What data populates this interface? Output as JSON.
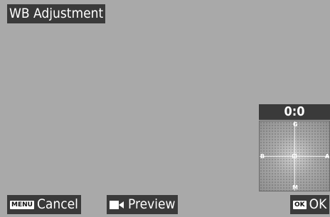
{
  "title": "WB Adjustment",
  "wb_panel": {
    "value": "0:0",
    "axis_labels": {
      "top": "G",
      "bottom": "M",
      "left": "B",
      "right": "A"
    },
    "cursor": {
      "x": 0,
      "y": 0
    }
  },
  "footer": {
    "cancel": {
      "key": "MENU",
      "label": "Cancel"
    },
    "preview": {
      "icon": "movie-camera-icon",
      "label": "Preview"
    },
    "ok": {
      "key": "OK",
      "label": "OK"
    }
  },
  "colors": {
    "background": "#a9a9a9",
    "panel": "#3a3a3a",
    "text": "#ffffff"
  }
}
